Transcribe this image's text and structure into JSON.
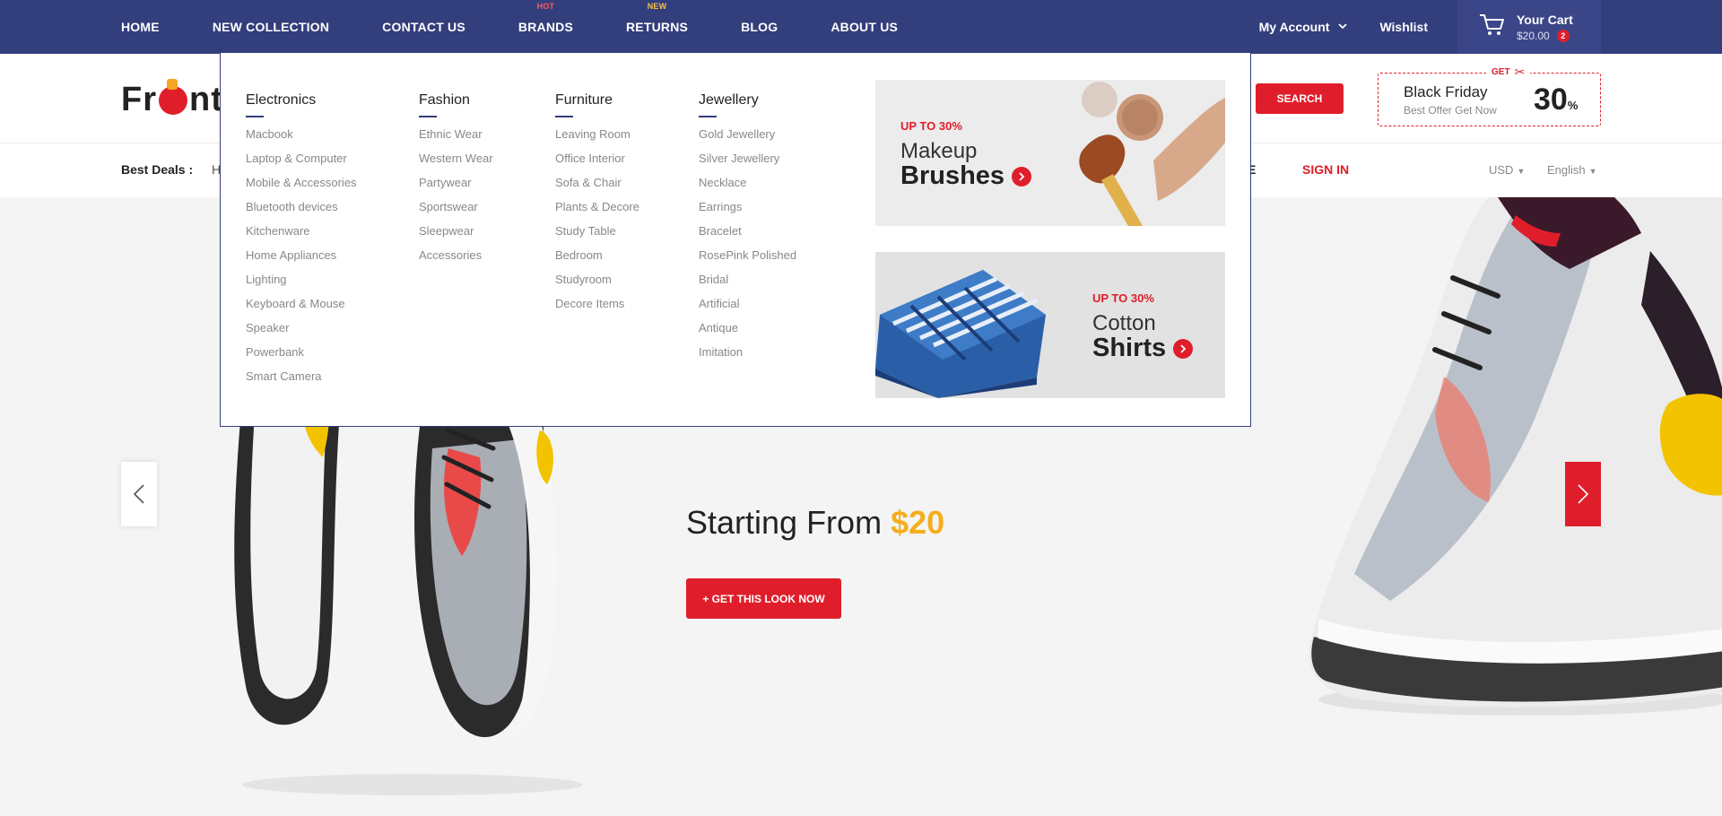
{
  "topnav": {
    "items": [
      {
        "label": "HOME",
        "tag": ""
      },
      {
        "label": "NEW COLLECTION",
        "tag": ""
      },
      {
        "label": "CONTACT US",
        "tag": ""
      },
      {
        "label": "BRANDS",
        "tag": "HOT"
      },
      {
        "label": "RETURNS",
        "tag": "NEW"
      },
      {
        "label": "BLOG",
        "tag": ""
      },
      {
        "label": "ABOUT US",
        "tag": ""
      }
    ],
    "account": "My Account",
    "wishlist": "Wishlist",
    "cart": {
      "title": "Your Cart",
      "amount": "$20.00",
      "count": "2"
    }
  },
  "header": {
    "logo": {
      "part1": "Fr",
      "part2": "nt"
    },
    "search_button": "SEARCH",
    "promo": {
      "get": "GET",
      "title": "Black Friday",
      "subtitle": "Best Offer Get Now",
      "value": "30",
      "unit": "%"
    }
  },
  "subbar": {
    "best_deals": "Best Deals :",
    "fragment_left": "H",
    "fragment_right": "E",
    "sign_in": "SIGN IN",
    "currency": "USD",
    "language": "English"
  },
  "mega_menu": {
    "columns": [
      {
        "title": "Electronics",
        "items": [
          "Macbook",
          "Laptop & Computer",
          "Mobile & Accessories",
          "Bluetooth devices",
          "Kitchenware",
          "Home Appliances",
          "Lighting",
          "Keyboard & Mouse",
          "Speaker",
          "Powerbank",
          "Smart Camera"
        ]
      },
      {
        "title": "Fashion",
        "items": [
          "Ethnic Wear",
          "Western Wear",
          "Partywear",
          "Sportswear",
          "Sleepwear",
          "Accessories"
        ]
      },
      {
        "title": "Furniture",
        "items": [
          "Leaving Room",
          "Office Interior",
          "Sofa & Chair",
          "Plants & Decore",
          "Study Table",
          "Bedroom",
          "Studyroom",
          "Decore Items"
        ]
      },
      {
        "title": "Jewellery",
        "items": [
          "Gold Jewellery",
          "Silver Jewellery",
          "Necklace",
          "Earrings",
          "Bracelet",
          "RosePink Polished",
          "Bridal",
          "Artificial",
          "Antique",
          "Imitation"
        ]
      }
    ],
    "banners": [
      {
        "offer": "UP TO 30%",
        "line1": "Makeup",
        "line2": "Brushes"
      },
      {
        "offer": "UP TO 30%",
        "line1": "Cotton",
        "line2": "Shirts"
      }
    ]
  },
  "hero": {
    "starting_text": "Starting From",
    "price": "$20",
    "cta": "+ GET THIS LOOK NOW"
  },
  "colors": {
    "nav_bg": "#333e7c",
    "accent_red": "#e01e2b",
    "price_yellow": "#f5ae1b"
  }
}
